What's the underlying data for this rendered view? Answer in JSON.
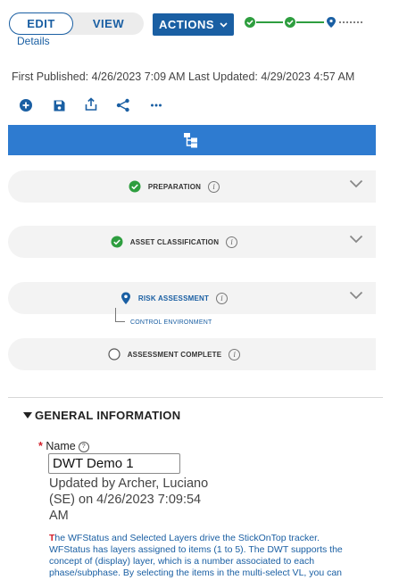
{
  "header": {
    "edit_label": "EDIT",
    "view_label": "VIEW",
    "actions_label": "ACTIONS",
    "details_link": "Details"
  },
  "meta": {
    "published_text": "First Published: 4/26/2023 7:09 AM Last Updated: 4/29/2023 4:57 AM"
  },
  "toolbar": {
    "icons": [
      "add-icon",
      "save-icon",
      "export-icon",
      "share-icon",
      "more-icon"
    ]
  },
  "tracker": {
    "bar_icon": "hierarchy-icon",
    "phases": [
      {
        "label": "PREPARATION",
        "status": "complete"
      },
      {
        "label": "ASSET CLASSIFICATION",
        "status": "complete"
      },
      {
        "label": "RISK ASSESSMENT",
        "status": "current",
        "sub": "CONTROL ENVIRONMENT"
      },
      {
        "label": "ASSESSMENT COMPLETE",
        "status": "pending"
      }
    ]
  },
  "section": {
    "title": "GENERAL INFORMATION"
  },
  "form": {
    "name_label": "Name",
    "name_value": "DWT Demo 1",
    "updated_text": "Updated by Archer, Luciano (SE) on 4/26/2023 7:09:54 AM",
    "description_first": "T",
    "description_rest": "he WFStatus and Selected Layers drive the StickOnTop tracker. WFStatus has layers assigned to items (1 to 5). The DWT supports the concept of (display) layer, which is a number associated to each phase/subphase. By selecting the items in the multi-select VL, you can"
  },
  "colors": {
    "primary": "#1a5fa3",
    "bar": "#2e7bd0",
    "complete": "#2e9e3f",
    "required": "#d21f2b"
  }
}
